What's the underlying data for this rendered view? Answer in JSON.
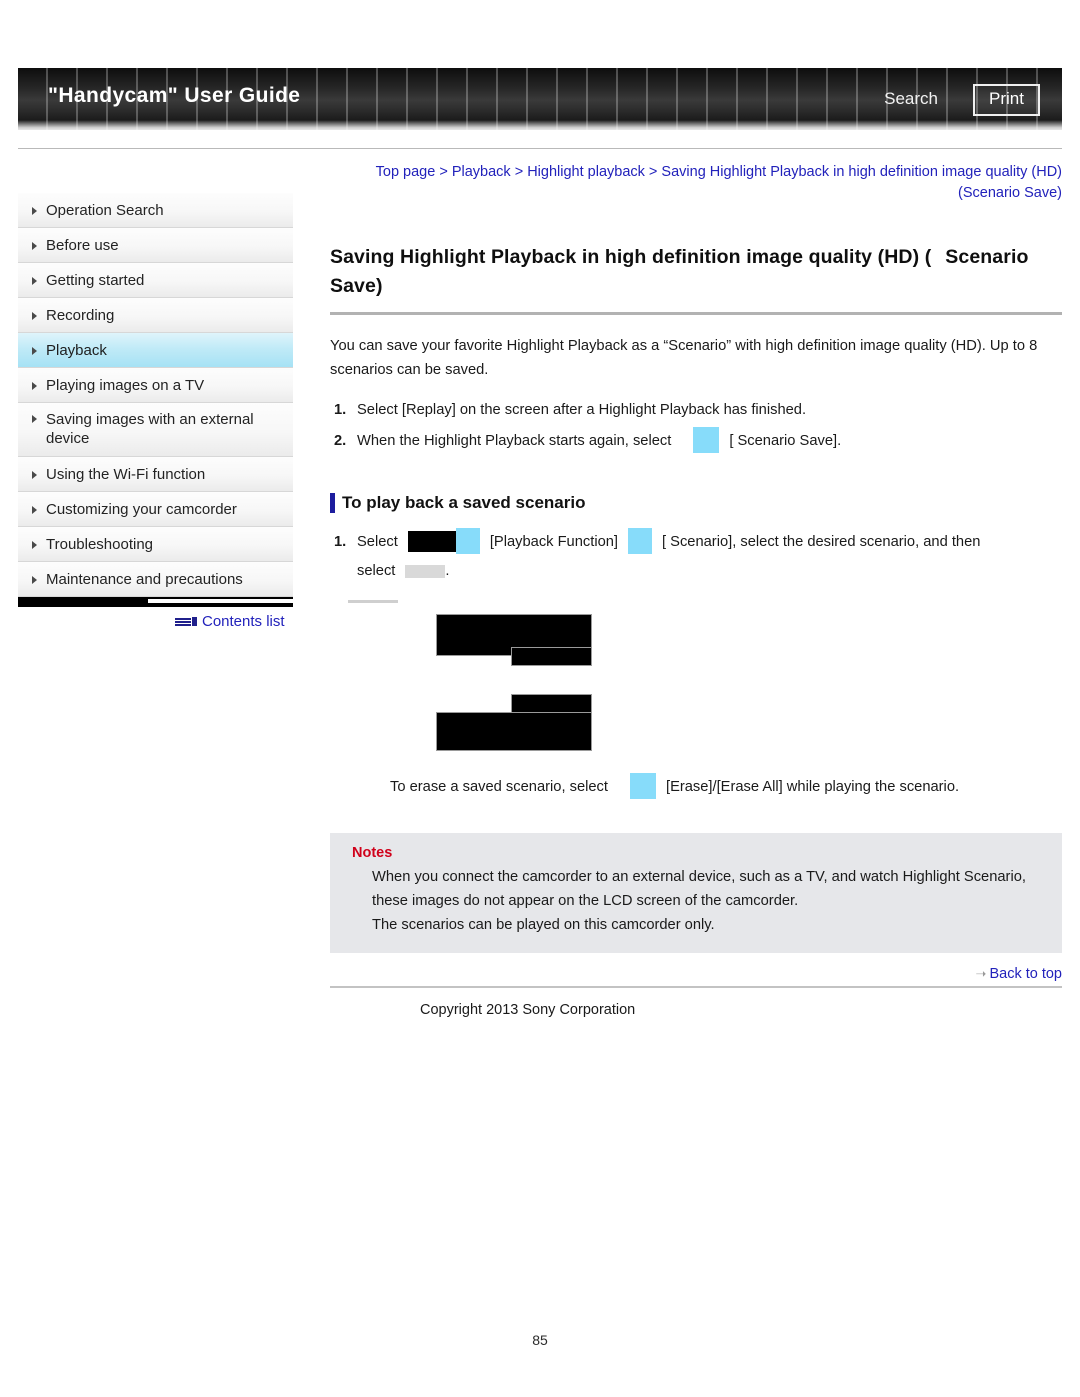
{
  "header": {
    "title": "\"Handycam\" User Guide",
    "search_label": "Search",
    "print_label": "Print"
  },
  "breadcrumb": {
    "full_text": "Top page > Playback > Highlight playback > Saving Highlight Playback in high definition image quality (HD) (Scenario Save)",
    "items": [
      "Top page",
      "Playback",
      "Highlight playback",
      "Saving Highlight Playback in high definition image quality (HD) (Scenario Save)"
    ],
    "separator": ">"
  },
  "sidebar": {
    "items": [
      {
        "label": "Operation Search",
        "active": false
      },
      {
        "label": "Before use",
        "active": false
      },
      {
        "label": "Getting started",
        "active": false
      },
      {
        "label": "Recording",
        "active": false
      },
      {
        "label": "Playback",
        "active": true
      },
      {
        "label": "Playing images on a TV",
        "active": false
      },
      {
        "label": "Saving images with an external device",
        "active": false
      },
      {
        "label": "Using the Wi-Fi function",
        "active": false
      },
      {
        "label": "Customizing your camcorder",
        "active": false
      },
      {
        "label": "Troubleshooting",
        "active": false
      },
      {
        "label": "Maintenance and precautions",
        "active": false
      }
    ],
    "contents_list_label": "Contents list"
  },
  "main": {
    "title_part1": "Saving Highlight Playback in high definition image quality (HD) (",
    "title_part2": "Scenario Save)",
    "intro": "You can save your favorite Highlight Playback as a “Scenario” with high definition image quality (HD). Up to 8 scenarios can be saved.",
    "steps": [
      {
        "num": "1.",
        "text": "Select [Replay] on the screen after a Highlight Playback has finished."
      },
      {
        "num": "2.",
        "text_before": "When the Highlight Playback starts again, select",
        "text_after": "[  Scenario Save]."
      }
    ],
    "section_title": "To play back a saved scenario",
    "playback_step": {
      "num": "1.",
      "text_a": "Select",
      "text_b": "[Playback Function]",
      "text_c": "[  Scenario], select the desired scenario, and then",
      "text_d": "select",
      "text_e": "."
    },
    "erase_line_before": "To erase a saved scenario, select",
    "erase_line_after": "[Erase]/[Erase All] while playing the scenario.",
    "notes": {
      "title": "Notes",
      "lines": [
        "When you connect the camcorder to an external device, such as a TV, and watch Highlight Scenario, these images do not appear on the LCD screen of the camcorder.",
        "The scenarios can be played on this camcorder only."
      ]
    }
  },
  "footer": {
    "back_to_top": "Back to top",
    "copyright": "Copyright 2013 Sony Corporation",
    "page_number": "85"
  },
  "colors": {
    "link": "#2222bb",
    "accent_bar": "#1d1d9e",
    "active_item": "#a6e2f5",
    "notes_bg": "#e6e7ea",
    "notes_title": "#d0021b",
    "missing_image_cyan": "#87dcfa",
    "missing_image_black": "#000000",
    "missing_image_gray": "#d9d9d9"
  }
}
